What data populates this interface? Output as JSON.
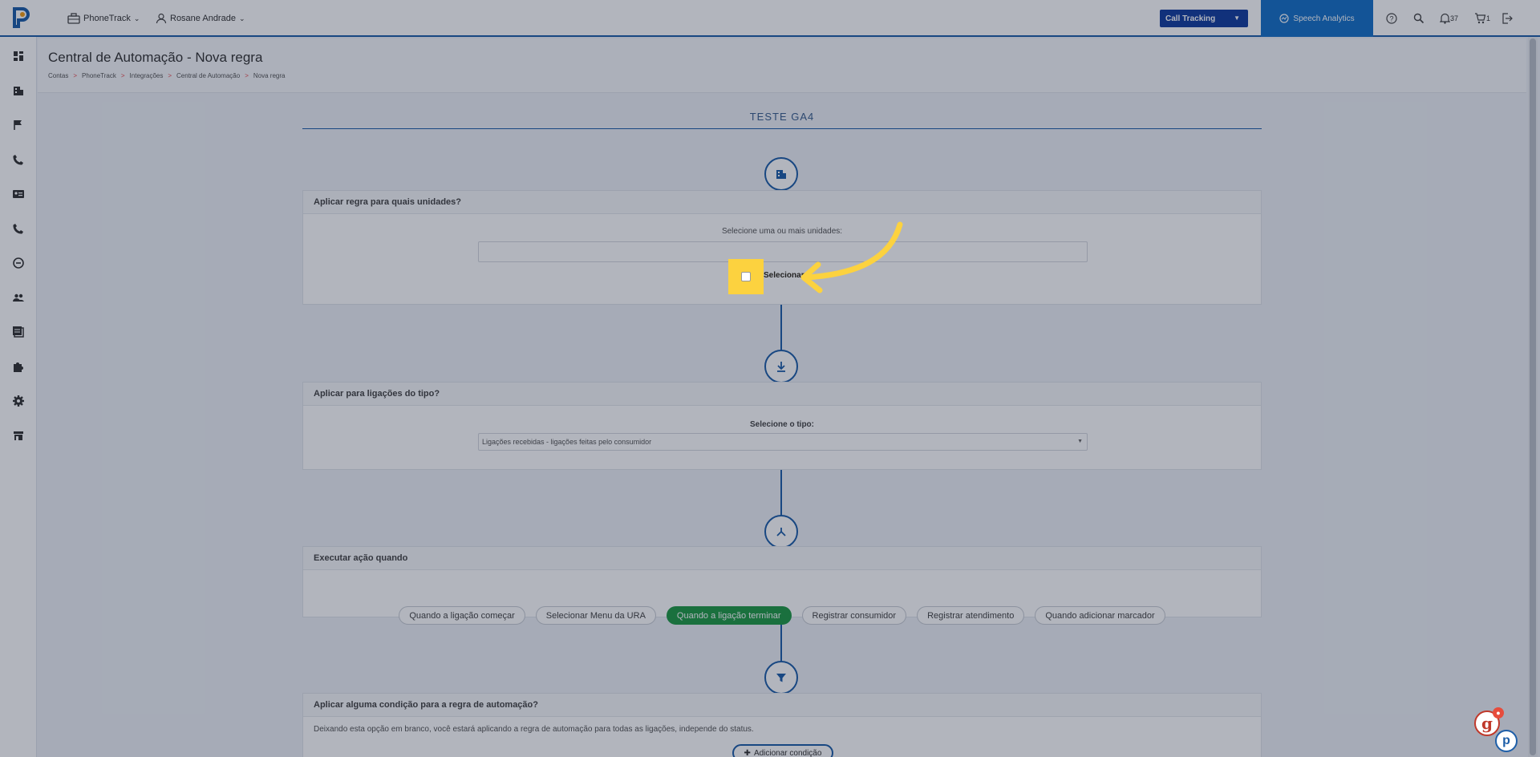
{
  "topbar": {
    "product_menu": "PhoneTrack",
    "user_menu": "Rosane Andrade",
    "call_tracking": "Call Tracking",
    "speech_analytics": "Speech Analytics",
    "notifications_count": "37",
    "cart_count": "1"
  },
  "header": {
    "title": "Central de Automação - Nova regra",
    "breadcrumb": [
      "Contas",
      "PhoneTrack",
      "Integrações",
      "Central de Automação",
      "Nova regra"
    ]
  },
  "rule": {
    "name": "TESTE GA4"
  },
  "units_card": {
    "title": "Aplicar regra para quais unidades?",
    "label": "Selecione uma ou mais unidades:",
    "input_value": "",
    "select_all": "Selecionar"
  },
  "type_card": {
    "title": "Aplicar para ligações do tipo?",
    "label": "Selecione o tipo:",
    "selected": "Ligações recebidas - ligações feitas pelo consumidor"
  },
  "action_card": {
    "title": "Executar ação quando",
    "options": [
      "Quando a ligação começar",
      "Selecionar Menu da URA",
      "Quando a ligação terminar",
      "Registrar consumidor",
      "Registrar atendimento",
      "Quando adicionar marcador"
    ],
    "active_index": 2
  },
  "condition_card": {
    "title": "Aplicar alguma condição para a regra de automação?",
    "description": "Deixando esta opção em branco, você estará aplicando a regra de automação para todas as ligações, independe do status.",
    "add_button": "Adicionar condição"
  },
  "colors": {
    "primary": "#1d5ea8",
    "active": "#1f9a45",
    "highlight": "#fcd23f",
    "call_tracking": "#123d9e",
    "speech": "#1671c8"
  },
  "sidebar_icons": [
    "dashboard-icon",
    "building-icon",
    "flag-icon",
    "phone-icon",
    "contact-card-icon",
    "phone-call-icon",
    "minus-circle-icon",
    "users-icon",
    "library-icon",
    "puzzle-icon",
    "gear-icon",
    "store-icon"
  ]
}
